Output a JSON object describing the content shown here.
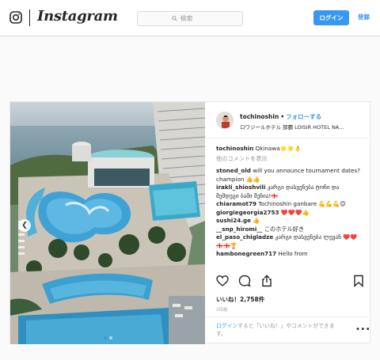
{
  "nav": {
    "wordmark": "Instagram",
    "search_placeholder": "検索",
    "login_label": "ログイン",
    "signup_label": "登録",
    "icons": [
      "camera-icon",
      "search-icon"
    ]
  },
  "post": {
    "username": "tochinoshin",
    "separator": "•",
    "follow_label": "フォローする",
    "location": "ロワジールホテル 那覇 LOISIR HOTEL NA...",
    "caption": {
      "user": "tochinoshin",
      "text": "Okinawa🌟🌟👌"
    },
    "view_comments": "他のコメントを表示",
    "comments": [
      {
        "user": "stoned_old",
        "text": "will you announce tournament dates? champion 👍👍"
      },
      {
        "user": "irakli_shioshvili",
        "text": "კარგი დასვენება ტოჩი და შემდეგი ბაში შენია!🇬🇪"
      },
      {
        "user": "chiaramot79",
        "text": "Tochinoshin ganbare 💪💪💪😊"
      },
      {
        "user": "giorgiegeorgia2753",
        "text": "❤️❤️❤️👍"
      },
      {
        "user": "sushi24.ge",
        "text": "👍"
      },
      {
        "user": "__snp_hiromi__",
        "text": "このホテル好き"
      },
      {
        "user": "el_paso_chigladze",
        "text": "კარგი დასვენება ლევან ❤️❤️🇬🇪🇬🇪🏆"
      },
      {
        "user": "hambonegreen717",
        "text": "Hello from"
      }
    ],
    "likes_label": "いいね！2,758件",
    "time_label": "2日前",
    "footer": {
      "login_link": "ログイン",
      "message": "すると「いいね！」やコメントができます。"
    },
    "more_options": "•••",
    "icons": [
      "heart-icon",
      "comment-icon",
      "share-icon",
      "bookmark-icon",
      "chevron-left-icon"
    ],
    "carousel": {
      "total": 2,
      "active": 1
    }
  },
  "colors": {
    "accent": "#3897f0",
    "border": "#dbdbdb",
    "background": "#fafafa"
  }
}
